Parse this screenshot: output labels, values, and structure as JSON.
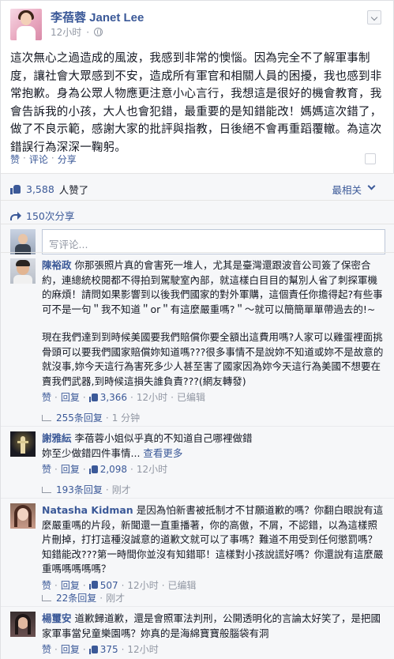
{
  "post": {
    "author": "李蓓蓉 Janet Lee",
    "time": "12小时",
    "text": "這次無心之過造成的風波，我感到非常的懊惱。因為完全不了解軍事制度，讓社會大眾感到不安，造成所有軍官和相關人員的困擾，我也感到非常抱歉。身為公眾人物應更注意小心言行，我想這是很好的機會教育，我會告訴我的小孩，大人也會犯錯，最重要的是知錯能改！媽媽這次錯了，做了不良示範，感謝大家的批評與指教，日後絕不會再重蹈覆轍。為這次錯誤行為深深一鞠躬。",
    "actions": [
      "赞",
      "评论",
      "分享"
    ],
    "likes_count": "3,588",
    "likes_suffix": "人赞了",
    "sort_label": "最相关",
    "shares": "150次分享",
    "compose_placeholder": "写评论..."
  },
  "comments": [
    {
      "name": "陳裕政",
      "text": "你那張照片真的會害死一堆人，尤其是臺灣還跟波音公司簽了保密合約，連總統校閱都不得拍到駕駛室內部，就這樣白目目的幫別人省了刺探軍機的麻煩！請問如果影響到以後我們國家的對外軍購，這個責任你擔得起?有些事可不是一句＂我不知道＂or＂有這麼嚴重嗎?＂～就可以簡簡單單帶過去的!~",
      "text2": "現在我們達到到時候美國要我們賠償你要全額出這費用嗎?人家可以雞蛋裡面挑骨頭可以要我們國家賠償妳知道嗎???很多事情不是說妳不知道或妳不是故意的就沒事,妳今天這行為害死多少人甚至害了國家因為妳今天這行為美國不想要在賣我們武器,到時候這損失誰負責???(網友轉發)",
      "like": "赞",
      "reply": "回复",
      "likes": "3,366",
      "time": "12小时",
      "edited": "已编辑",
      "replies": "255条回复",
      "replies_time": "1 分钟"
    },
    {
      "name": "謝雅紜",
      "text": "李蓓蓉小姐似乎真的不知道自己哪裡做錯",
      "text2": "妳至少做錯四件事情...",
      "see_more": "查看更多",
      "like": "赞",
      "reply": "回复",
      "likes": "2,098",
      "time": "12小时",
      "replies": "193条回复",
      "replies_time": "刚才"
    },
    {
      "name": "Natasha Kidman",
      "text": "是因為怕新書被抵制才不甘願道歉的嗎？你翻白眼說有這麼嚴重嗎的片段，新聞還一直重播著，你的高傲，不屑，不認錯，以為這樣照片刪掉，打打這種沒誠意的道歉文就可以了事嗎？難道不用受到任何懲罰嗎？知錯能改???第一時間你並沒有知錯耶！這樣對小孩說謊好嗎？你還說有這麼嚴重嗎嗎嗎嗎嗎？",
      "like": "赞",
      "reply": "回复",
      "likes": "507",
      "time": "12小时",
      "edited": "已编辑",
      "replies": "22条回复",
      "replies_time": "刚才"
    },
    {
      "name": "楊璽安",
      "text": "道歉歸道歉，還是會照軍法判刑，公開透明化的言論太好笑了，是把國家軍事當兒童樂園嗎？妳真的是海綿寶寶般腦袋有洞",
      "like": "赞",
      "reply": "回复",
      "likes": "375",
      "time": "12小时"
    }
  ]
}
